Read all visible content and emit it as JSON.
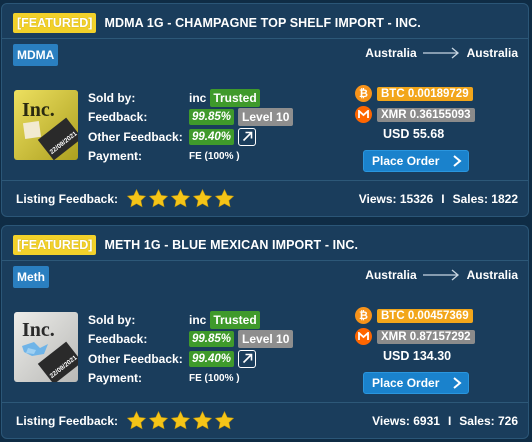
{
  "listings": [
    {
      "featured_label": "[FEATURED]",
      "title": "MDMA 1G - CHAMPAGNE TOP SHELF IMPORT - INC.",
      "category": "MDMA",
      "ship_from": "Australia",
      "ship_to": "Australia",
      "image_text": "Inc.",
      "image_date": "22/09/2021",
      "sold_by_label": "Sold by:",
      "vendor": "inc",
      "trusted_label": "Trusted",
      "feedback_label": "Feedback:",
      "feedback": "99.85%",
      "level": "Level 10",
      "other_feedback_label": "Other Feedback:",
      "other_feedback": "99.40%",
      "payment_label": "Payment:",
      "payment": "FE (100% )",
      "btc": "BTC 0.00189729",
      "xmr": "XMR 0.36155093",
      "usd": "USD 55.68",
      "order_label": "Place Order",
      "listing_feedback_label": "Listing Feedback:",
      "rating": 5,
      "views": "Views: 15326",
      "sales": "Sales: 1822",
      "separator": "I"
    },
    {
      "featured_label": "[FEATURED]",
      "title": "METH 1G - BLUE MEXICAN IMPORT - INC.",
      "category": "Meth",
      "ship_from": "Australia",
      "ship_to": "Australia",
      "image_text": "Inc.",
      "image_date": "22/09/2021",
      "sold_by_label": "Sold by:",
      "vendor": "inc",
      "trusted_label": "Trusted",
      "feedback_label": "Feedback:",
      "feedback": "99.85%",
      "level": "Level 10",
      "other_feedback_label": "Other Feedback:",
      "other_feedback": "99.40%",
      "payment_label": "Payment:",
      "payment": "FE (100% )",
      "btc": "BTC 0.00457369",
      "xmr": "XMR 0.87157292",
      "usd": "USD 134.30",
      "order_label": "Place Order",
      "listing_feedback_label": "Listing Feedback:",
      "rating": 5,
      "views": "Views: 6931",
      "sales": "Sales: 726",
      "separator": "I"
    }
  ],
  "colors": {
    "page_bg": "#0f2c45",
    "card_bg": "#1a3d5c",
    "featured": "#f2d12a",
    "category": "#2a7fc0",
    "trusted": "#3f9a2b",
    "level": "#8e8e8e",
    "btc": "#f7931a",
    "xmr": "#ff6600",
    "button": "#1a82cc",
    "star": "#f5c518"
  },
  "icons": {
    "btc": "bitcoin-icon",
    "xmr": "monero-icon",
    "route": "arrow-right-icon",
    "order": "chevron-right-icon",
    "link": "external-link-icon",
    "rating": "star-icon"
  }
}
